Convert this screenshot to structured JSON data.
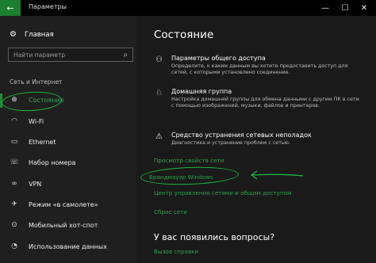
{
  "window": {
    "title": "Параметры",
    "back_icon": "←",
    "minimize_icon": "—",
    "maximize_icon": "☐",
    "close_icon": "✕"
  },
  "sidebar": {
    "home_label": "Главная",
    "home_icon": "⚙",
    "search_placeholder": "Найти параметр",
    "search_icon": "⌕",
    "section_label": "Сеть и Интернет",
    "items": [
      {
        "label": "Состояние",
        "icon": "⊕"
      },
      {
        "label": "Wi-Fi",
        "icon": "◠"
      },
      {
        "label": "Ethernet",
        "icon": "▭"
      },
      {
        "label": "Набор номера",
        "icon": "☏"
      },
      {
        "label": "VPN",
        "icon": "∞"
      },
      {
        "label": "Режим «в самолете»",
        "icon": "✈"
      },
      {
        "label": "Мобильный хот-спот",
        "icon": "⊙"
      },
      {
        "label": "Использование данных",
        "icon": "◔"
      }
    ]
  },
  "main": {
    "title": "Состояние",
    "entries": [
      {
        "icon": "⚇",
        "title": "Параметры общего доступа",
        "desc": "Определите, к каким данным вы хотите предоставить доступ для сетей, с которыми установлено соединение."
      },
      {
        "icon": "♘",
        "title": "Домашняя группа",
        "desc": "Настройка домашней группы для обмена данными с другим ПК в сети с помощью изображений, музыки, файлов и принтеров."
      },
      {
        "icon": "⚠",
        "title": "Средство устранения сетевых неполадок",
        "desc": "Диагностика и устранение проблем с сетью."
      }
    ],
    "links": {
      "view_properties": "Просмотр свойств сети",
      "firewall": "Брандмауэр Windows",
      "network_center": "Центр управления сетями и общим доступом",
      "reset": "Сброс сети"
    },
    "questions_title": "У вас появились вопросы?",
    "help_link": "Вызов справки"
  },
  "colors": {
    "accent": "#1a7f2e",
    "link": "#2aa24a",
    "annotation": "#1db542"
  }
}
